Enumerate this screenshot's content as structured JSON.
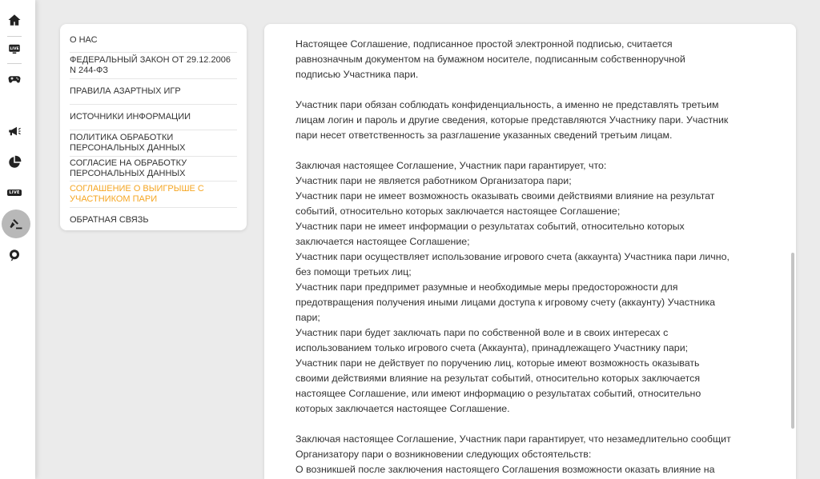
{
  "rail": {
    "items": [
      {
        "name": "home-icon"
      },
      {
        "name": "live-icon",
        "badge": "LIVE"
      },
      {
        "name": "gamepad-icon"
      },
      {
        "name": "megaphone-icon"
      },
      {
        "name": "pie-chart-icon"
      },
      {
        "name": "live-sport-icon",
        "badge": "LIVE"
      },
      {
        "name": "gavel-icon",
        "active": true
      },
      {
        "name": "support-icon"
      }
    ]
  },
  "menu": {
    "items": [
      {
        "label": "О НАС"
      },
      {
        "label_line1": "ФЕДЕРАЛЬНЫЙ ЗАКОН ОТ 29.12.2006",
        "label_line2": "N 244-ФЗ"
      },
      {
        "label": "ПРАВИЛА АЗАРТНЫХ ИГР"
      },
      {
        "label": "ИСТОЧНИКИ ИНФОРМАЦИИ"
      },
      {
        "label_line1": "ПОЛИТИКА ОБРАБОТКИ",
        "label_line2": "ПЕРСОНАЛЬНЫХ ДАННЫХ"
      },
      {
        "label_line1": "СОГЛАСИЕ НА ОБРАБОТКУ",
        "label_line2": "ПЕРСОНАЛЬНЫХ ДАННЫХ"
      },
      {
        "label_line1": "СОГЛАШЕНИЕ О ВЫИГРЫШЕ С",
        "label_line2": "УЧАСТНИКОМ ПАРИ",
        "active": true
      },
      {
        "label": "ОБРАТНАЯ СВЯЗЬ"
      }
    ]
  },
  "content": {
    "p1": [
      "Настоящее Соглашение, подписанное простой электронной подписью, считается",
      "равнозначным документом на бумажном носителе, подписанным собственноручной",
      "подписью Участника пари."
    ],
    "p2": [
      "Участник пари обязан соблюдать конфиденциальность, а именно не представлять третьим",
      "лицам логин и пароль и другие сведения, которые представляются Участнику пари. Участник",
      "пари несет ответственность за разглашение указанных сведений третьим лицам."
    ],
    "p3": [
      "Заключая настоящее Соглашение, Участник пари гарантирует, что:",
      "Участник пари не является работником Организатора пари;",
      "Участник пари не имеет возможность оказывать своими действиями влияние на результат",
      "событий, относительно которых заключается настоящее Соглашение;",
      "Участник пари не имеет информации о результатах событий, относительно которых",
      "заключается настоящее Соглашение;",
      "Участник пари осуществляет использование игрового счета (аккаунта) Участника пари лично,",
      "без помощи третьих лиц;",
      "Участник пари предпримет разумные и необходимые меры предосторожности для",
      "предотвращения получения иными лицами доступа к игровому счету (аккаунту) Участника",
      "пари;",
      "Участник пари будет заключать пари по собственной воле и в своих интересах с",
      "использованием только игрового счета (Аккаунта), принадлежащего Участнику пари;",
      "Участник пари не действует по поручению лиц, которые имеют возможность оказывать",
      "своими действиями влияние на результат событий, относительно которых заключается",
      "настоящее Соглашение, или имеют информацию о результатах событий, относительно",
      "которых заключается настоящее Соглашение."
    ],
    "p4": [
      "Заключая настоящее Соглашение, Участник пари гарантирует, что незамедлительно сообщит",
      "Организатору пари о возникновении следующих обстоятельств:",
      "О возникшей после заключения настоящего Соглашения возможности оказать влияние на"
    ]
  },
  "colors": {
    "accent": "#f5a623",
    "background": "#ebebeb",
    "card": "#ffffff",
    "text": "#333333"
  }
}
